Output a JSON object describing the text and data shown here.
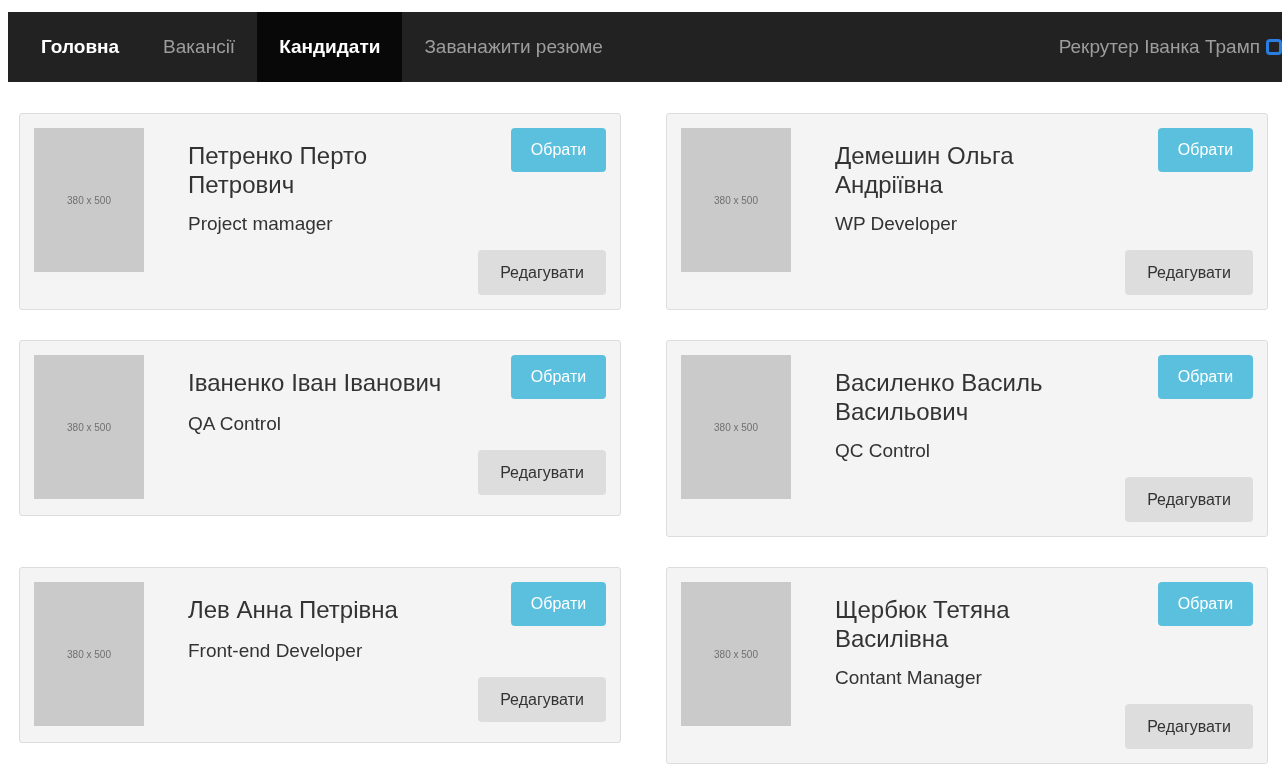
{
  "navbar": {
    "brand": "Головна",
    "items": [
      {
        "label": "Вакансії",
        "selected": false
      },
      {
        "label": "Кандидати",
        "selected": true
      },
      {
        "label": "Заванажити резюме",
        "selected": false
      }
    ],
    "user": "Рекрутер Іванка Трамп"
  },
  "candidates": [
    {
      "photo_label": "380 x 500",
      "name": "Петренко Перто Петрович",
      "role": "Project mamager",
      "select_button": "Обрати",
      "edit_button": "Редагувати"
    },
    {
      "photo_label": "380 x 500",
      "name": "Демешин Ольга Андріївна",
      "role": "WP Developer",
      "select_button": "Обрати",
      "edit_button": "Редагувати"
    },
    {
      "photo_label": "380 x 500",
      "name": "Іваненко Іван Іванович",
      "role": "QA Control",
      "select_button": "Обрати",
      "edit_button": "Редагувати"
    },
    {
      "photo_label": "380 x 500",
      "name": "Василенко Василь Васильович",
      "role": "QC Control",
      "select_button": "Обрати",
      "edit_button": "Редагувати"
    },
    {
      "photo_label": "380 x 500",
      "name": "Лев Анна Петрівна",
      "role": "Front-end Developer",
      "select_button": "Обрати",
      "edit_button": "Редагувати"
    },
    {
      "photo_label": "380 x 500",
      "name": "Щербюк Тетяна Василівна",
      "role": "Contant Manager",
      "select_button": "Обрати",
      "edit_button": "Редагувати"
    }
  ]
}
